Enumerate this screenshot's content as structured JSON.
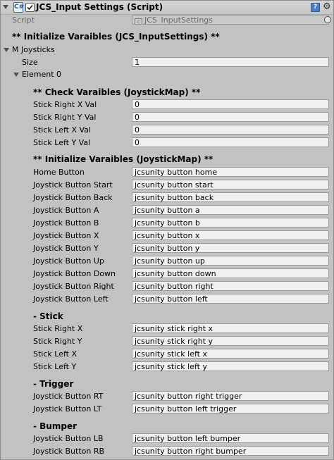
{
  "header": {
    "title": "JCS_Input Settings (Script)",
    "help_icon": "?",
    "icon_script": "C#"
  },
  "script_row": {
    "label": "Script",
    "value": "JCS_InputSettings"
  },
  "init_title": "** Initialize Varaibles (JCS_InputSettings) **",
  "joysticks": {
    "label": "M Joysticks",
    "size_label": "Size",
    "size_value": "1",
    "element_label": "Element 0"
  },
  "check_title": "** Check Varaibles (JoystickMap) **",
  "check_rows": [
    {
      "label": "Stick Right X Val",
      "value": "0"
    },
    {
      "label": "Stick Right Y Val",
      "value": "0"
    },
    {
      "label": "Stick Left X Val",
      "value": "0"
    },
    {
      "label": "Stick Left Y Val",
      "value": "0"
    }
  ],
  "map_title": "** Initialize Varaibles (JoystickMap) **",
  "button_rows": [
    {
      "label": "Home Button",
      "value": "jcsunity button home"
    },
    {
      "label": "Joystick Button Start",
      "value": "jcsunity button start"
    },
    {
      "label": "Joystick Button Back",
      "value": "jcsunity button back"
    },
    {
      "label": "Joystick Button A",
      "value": "jcsunity button a"
    },
    {
      "label": "Joystick Button B",
      "value": "jcsunity button b"
    },
    {
      "label": "Joystick Button X",
      "value": "jcsunity button x"
    },
    {
      "label": "Joystick Button Y",
      "value": "jcsunity button y"
    },
    {
      "label": "Joystick Button Up",
      "value": "jcsunity button up"
    },
    {
      "label": "Joystick Button Down",
      "value": "jcsunity button down"
    },
    {
      "label": "Joystick Button Right",
      "value": "jcsunity button right"
    },
    {
      "label": "Joystick Button Left",
      "value": "jcsunity button left"
    }
  ],
  "stick_title": "- Stick",
  "stick_rows": [
    {
      "label": "Stick Right X",
      "value": "jcsunity stick right x"
    },
    {
      "label": "Stick Right Y",
      "value": "jcsunity stick right y"
    },
    {
      "label": "Stick Left X",
      "value": "jcsunity stick left x"
    },
    {
      "label": "Stick Left Y",
      "value": "jcsunity stick left y"
    }
  ],
  "trigger_title": "- Trigger",
  "trigger_rows": [
    {
      "label": "Joystick Button RT",
      "value": "jcsunity button right trigger"
    },
    {
      "label": "Joystick Button LT",
      "value": "jcsunity button left trigger"
    }
  ],
  "bumper_title": "- Bumper",
  "bumper_rows": [
    {
      "label": "Joystick Button LB",
      "value": "jcsunity button left bumper"
    },
    {
      "label": "Joystick Button RB",
      "value": "jcsunity button right bumper"
    }
  ],
  "colors": {
    "panel_bg": "#c2c2c2",
    "field_bg": "#f0f0f0",
    "help_blue": "#4a7fc6"
  }
}
